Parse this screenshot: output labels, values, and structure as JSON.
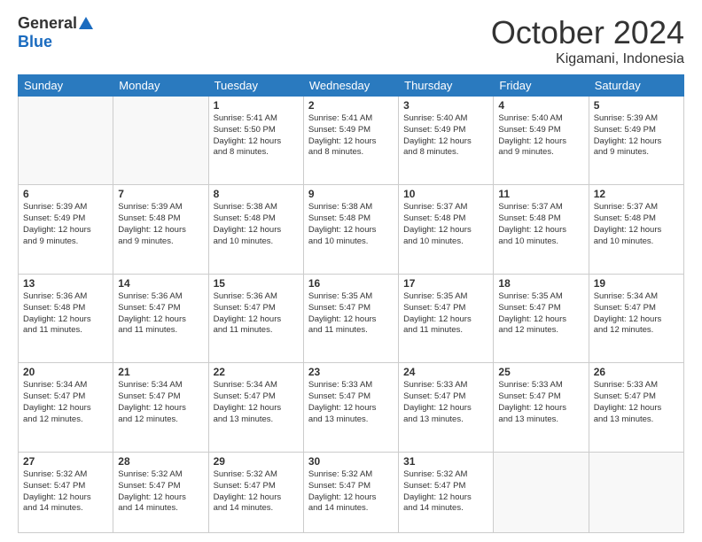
{
  "logo": {
    "general": "General",
    "blue": "Blue"
  },
  "title": "October 2024",
  "location": "Kigamani, Indonesia",
  "days_header": [
    "Sunday",
    "Monday",
    "Tuesday",
    "Wednesday",
    "Thursday",
    "Friday",
    "Saturday"
  ],
  "weeks": [
    [
      {
        "day": "",
        "info": ""
      },
      {
        "day": "",
        "info": ""
      },
      {
        "day": "1",
        "info": "Sunrise: 5:41 AM\nSunset: 5:50 PM\nDaylight: 12 hours\nand 8 minutes."
      },
      {
        "day": "2",
        "info": "Sunrise: 5:41 AM\nSunset: 5:49 PM\nDaylight: 12 hours\nand 8 minutes."
      },
      {
        "day": "3",
        "info": "Sunrise: 5:40 AM\nSunset: 5:49 PM\nDaylight: 12 hours\nand 8 minutes."
      },
      {
        "day": "4",
        "info": "Sunrise: 5:40 AM\nSunset: 5:49 PM\nDaylight: 12 hours\nand 9 minutes."
      },
      {
        "day": "5",
        "info": "Sunrise: 5:39 AM\nSunset: 5:49 PM\nDaylight: 12 hours\nand 9 minutes."
      }
    ],
    [
      {
        "day": "6",
        "info": "Sunrise: 5:39 AM\nSunset: 5:49 PM\nDaylight: 12 hours\nand 9 minutes."
      },
      {
        "day": "7",
        "info": "Sunrise: 5:39 AM\nSunset: 5:48 PM\nDaylight: 12 hours\nand 9 minutes."
      },
      {
        "day": "8",
        "info": "Sunrise: 5:38 AM\nSunset: 5:48 PM\nDaylight: 12 hours\nand 10 minutes."
      },
      {
        "day": "9",
        "info": "Sunrise: 5:38 AM\nSunset: 5:48 PM\nDaylight: 12 hours\nand 10 minutes."
      },
      {
        "day": "10",
        "info": "Sunrise: 5:37 AM\nSunset: 5:48 PM\nDaylight: 12 hours\nand 10 minutes."
      },
      {
        "day": "11",
        "info": "Sunrise: 5:37 AM\nSunset: 5:48 PM\nDaylight: 12 hours\nand 10 minutes."
      },
      {
        "day": "12",
        "info": "Sunrise: 5:37 AM\nSunset: 5:48 PM\nDaylight: 12 hours\nand 10 minutes."
      }
    ],
    [
      {
        "day": "13",
        "info": "Sunrise: 5:36 AM\nSunset: 5:48 PM\nDaylight: 12 hours\nand 11 minutes."
      },
      {
        "day": "14",
        "info": "Sunrise: 5:36 AM\nSunset: 5:47 PM\nDaylight: 12 hours\nand 11 minutes."
      },
      {
        "day": "15",
        "info": "Sunrise: 5:36 AM\nSunset: 5:47 PM\nDaylight: 12 hours\nand 11 minutes."
      },
      {
        "day": "16",
        "info": "Sunrise: 5:35 AM\nSunset: 5:47 PM\nDaylight: 12 hours\nand 11 minutes."
      },
      {
        "day": "17",
        "info": "Sunrise: 5:35 AM\nSunset: 5:47 PM\nDaylight: 12 hours\nand 11 minutes."
      },
      {
        "day": "18",
        "info": "Sunrise: 5:35 AM\nSunset: 5:47 PM\nDaylight: 12 hours\nand 12 minutes."
      },
      {
        "day": "19",
        "info": "Sunrise: 5:34 AM\nSunset: 5:47 PM\nDaylight: 12 hours\nand 12 minutes."
      }
    ],
    [
      {
        "day": "20",
        "info": "Sunrise: 5:34 AM\nSunset: 5:47 PM\nDaylight: 12 hours\nand 12 minutes."
      },
      {
        "day": "21",
        "info": "Sunrise: 5:34 AM\nSunset: 5:47 PM\nDaylight: 12 hours\nand 12 minutes."
      },
      {
        "day": "22",
        "info": "Sunrise: 5:34 AM\nSunset: 5:47 PM\nDaylight: 12 hours\nand 13 minutes."
      },
      {
        "day": "23",
        "info": "Sunrise: 5:33 AM\nSunset: 5:47 PM\nDaylight: 12 hours\nand 13 minutes."
      },
      {
        "day": "24",
        "info": "Sunrise: 5:33 AM\nSunset: 5:47 PM\nDaylight: 12 hours\nand 13 minutes."
      },
      {
        "day": "25",
        "info": "Sunrise: 5:33 AM\nSunset: 5:47 PM\nDaylight: 12 hours\nand 13 minutes."
      },
      {
        "day": "26",
        "info": "Sunrise: 5:33 AM\nSunset: 5:47 PM\nDaylight: 12 hours\nand 13 minutes."
      }
    ],
    [
      {
        "day": "27",
        "info": "Sunrise: 5:32 AM\nSunset: 5:47 PM\nDaylight: 12 hours\nand 14 minutes."
      },
      {
        "day": "28",
        "info": "Sunrise: 5:32 AM\nSunset: 5:47 PM\nDaylight: 12 hours\nand 14 minutes."
      },
      {
        "day": "29",
        "info": "Sunrise: 5:32 AM\nSunset: 5:47 PM\nDaylight: 12 hours\nand 14 minutes."
      },
      {
        "day": "30",
        "info": "Sunrise: 5:32 AM\nSunset: 5:47 PM\nDaylight: 12 hours\nand 14 minutes."
      },
      {
        "day": "31",
        "info": "Sunrise: 5:32 AM\nSunset: 5:47 PM\nDaylight: 12 hours\nand 14 minutes."
      },
      {
        "day": "",
        "info": ""
      },
      {
        "day": "",
        "info": ""
      }
    ]
  ]
}
